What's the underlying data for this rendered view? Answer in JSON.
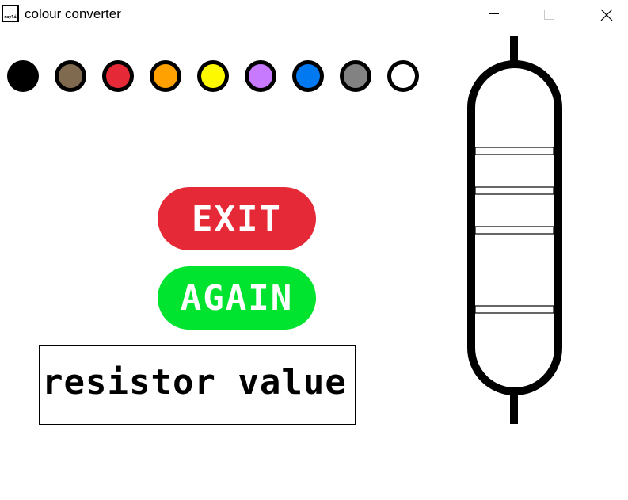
{
  "window": {
    "title": "colour converter",
    "icon_text": "raylib"
  },
  "swatches": [
    {
      "name": "black",
      "color": "#000000"
    },
    {
      "name": "brown",
      "color": "#7f6a4f"
    },
    {
      "name": "red",
      "color": "#e62937"
    },
    {
      "name": "orange",
      "color": "#ffa100"
    },
    {
      "name": "yellow",
      "color": "#fdf900"
    },
    {
      "name": "violet",
      "color": "#c87aff"
    },
    {
      "name": "blue",
      "color": "#0079f1"
    },
    {
      "name": "gray",
      "color": "#828282"
    },
    {
      "name": "white",
      "color": "#ffffff"
    }
  ],
  "buttons": {
    "exit_label": "EXIT",
    "again_label": "AGAIN",
    "exit_color": "#e62937",
    "again_color": "#00e430"
  },
  "result": {
    "label": "resistor value"
  },
  "resistor": {
    "band_count": 4,
    "band_colors": [
      "#ffffff",
      "#ffffff",
      "#ffffff",
      "#ffffff"
    ],
    "outline_color": "#000000"
  }
}
